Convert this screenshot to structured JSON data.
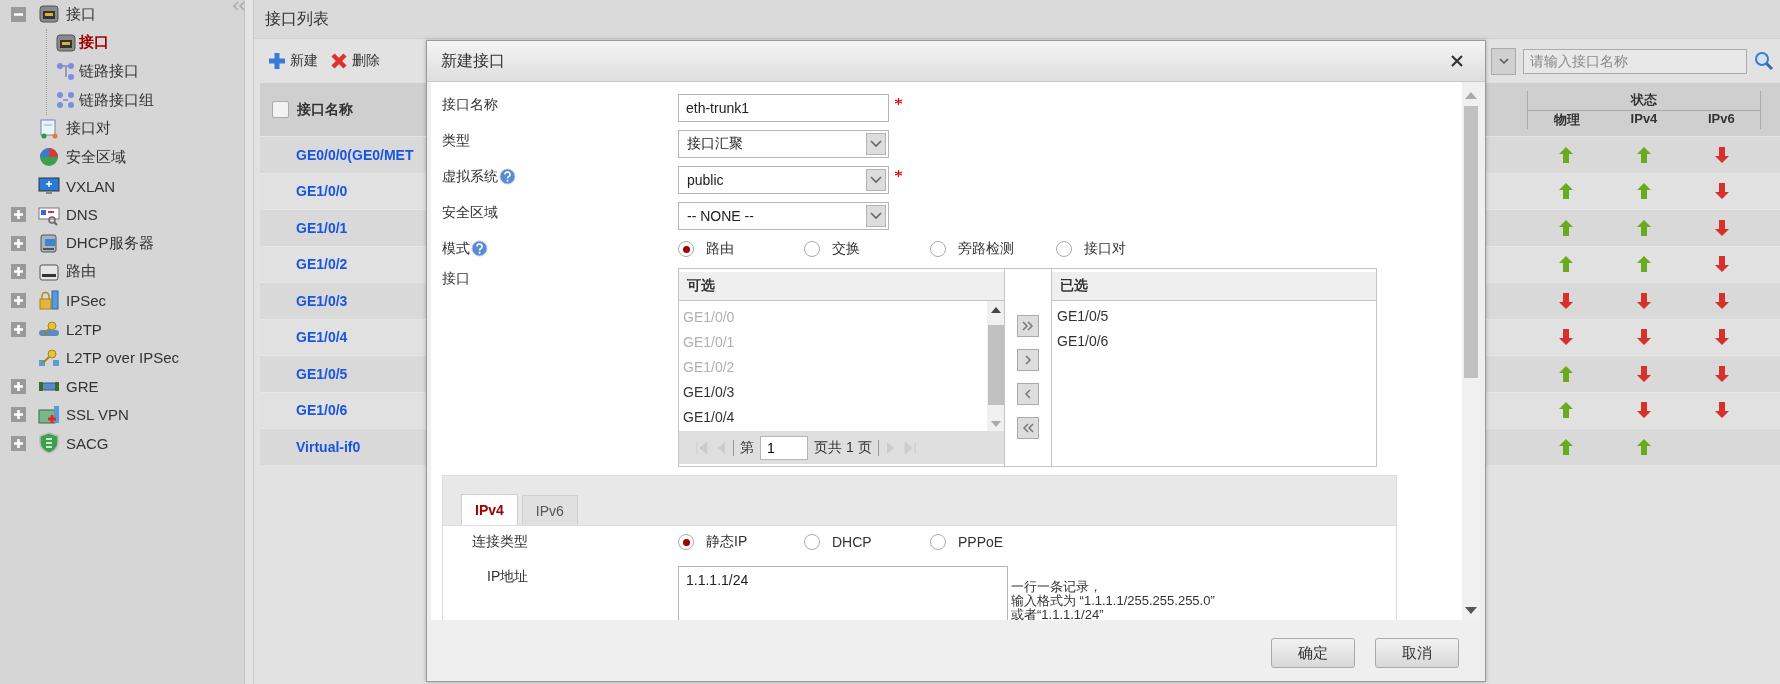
{
  "sidebar": {
    "items": [
      {
        "label": "接口",
        "expanded": true,
        "selected": false,
        "children": [
          {
            "label": "接口",
            "selected": true
          },
          {
            "label": "链路接口",
            "selected": false
          },
          {
            "label": "链路接口组",
            "selected": false
          }
        ]
      },
      {
        "label": "接口对",
        "selected": false
      },
      {
        "label": "安全区域",
        "selected": false
      },
      {
        "label": "VXLAN",
        "selected": false
      },
      {
        "label": "DNS",
        "expanded": false,
        "selected": false
      },
      {
        "label": "DHCP服务器",
        "expanded": false,
        "selected": false
      },
      {
        "label": "路由",
        "expanded": false,
        "selected": false
      },
      {
        "label": "IPSec",
        "expanded": false,
        "selected": false
      },
      {
        "label": "L2TP",
        "expanded": false,
        "selected": false
      },
      {
        "label": "L2TP over IPSec",
        "selected": false
      },
      {
        "label": "GRE",
        "expanded": false,
        "selected": false
      },
      {
        "label": "SSL VPN",
        "expanded": false,
        "selected": false
      },
      {
        "label": "SACG",
        "expanded": false,
        "selected": false
      }
    ]
  },
  "panel": {
    "title": "接口列表",
    "toolbar": {
      "buttons": [
        {
          "label": "新建",
          "kind": "add"
        },
        {
          "label": "删除",
          "kind": "delete"
        }
      ],
      "search": {
        "placeholder": "请输入接口名称"
      }
    },
    "table": {
      "select_all": {
        "checked": false
      },
      "name_column": "接口名称",
      "status_group": "状态",
      "status_columns": [
        "物理",
        "IPv4",
        "IPv6"
      ],
      "rows": [
        {
          "name": "GE0/0/0(GE0/MET",
          "status": [
            {
              "up": true
            },
            {
              "up": true
            },
            {
              "up": false
            }
          ]
        },
        {
          "name": "GE1/0/0",
          "status": [
            {
              "up": true
            },
            {
              "up": true
            },
            {
              "up": false
            }
          ]
        },
        {
          "name": "GE1/0/1",
          "status": [
            {
              "up": true
            },
            {
              "up": true
            },
            {
              "up": false
            }
          ]
        },
        {
          "name": "GE1/0/2",
          "status": [
            {
              "up": true
            },
            {
              "up": true
            },
            {
              "up": false
            }
          ]
        },
        {
          "name": "GE1/0/3",
          "status": [
            {
              "up": false
            },
            {
              "up": false
            },
            {
              "up": false
            }
          ]
        },
        {
          "name": "GE1/0/4",
          "status": [
            {
              "up": false
            },
            {
              "up": false
            },
            {
              "up": false
            }
          ]
        },
        {
          "name": "GE1/0/5",
          "status": [
            {
              "up": true
            },
            {
              "up": false
            },
            {
              "up": false
            }
          ]
        },
        {
          "name": "GE1/0/6",
          "status": [
            {
              "up": true
            },
            {
              "up": false
            },
            {
              "up": false
            }
          ]
        },
        {
          "name": "Virtual-if0",
          "status": [
            {
              "up": true
            },
            {
              "up": true
            }
          ]
        }
      ]
    }
  },
  "dialog": {
    "title": "新建接口",
    "fields": [
      {
        "kind": "text",
        "label": "接口名称",
        "help": false,
        "value": "eth-trunk1",
        "required": true
      },
      {
        "kind": "select",
        "label": "类型",
        "help": false,
        "value": "接口汇聚",
        "required": false
      },
      {
        "kind": "select",
        "label": "虚拟系统",
        "help": true,
        "value": "public",
        "required": true
      },
      {
        "kind": "select",
        "label": "安全区域",
        "help": false,
        "value": "-- NONE --",
        "required": false
      },
      {
        "kind": "radio",
        "label": "模式",
        "help": true,
        "options": [
          {
            "label": "路由",
            "selected": true
          },
          {
            "label": "交换",
            "selected": false
          },
          {
            "label": "旁路检测",
            "selected": false
          },
          {
            "label": "接口对",
            "selected": false
          }
        ]
      },
      {
        "kind": "transfer",
        "label": "接口",
        "help": false,
        "available": {
          "title": "可选",
          "items": [
            {
              "label": "GE1/0/0",
              "disabled": true
            },
            {
              "label": "GE1/0/1",
              "disabled": true
            },
            {
              "label": "GE1/0/2",
              "disabled": true
            },
            {
              "label": "GE1/0/3",
              "disabled": false
            },
            {
              "label": "GE1/0/4",
              "disabled": false
            }
          ],
          "pager": {
            "prefix": "第",
            "page": "1",
            "suffix": "页共 1 页"
          }
        },
        "chosen": {
          "title": "已选",
          "items": [
            "GE1/0/5",
            "GE1/0/6"
          ]
        }
      }
    ],
    "tabs": [
      {
        "label": "IPv4",
        "selected": true
      },
      {
        "label": "IPv6",
        "selected": false
      }
    ],
    "connection": {
      "label": "连接类型",
      "options": [
        {
          "label": "静态IP",
          "selected": true
        },
        {
          "label": "DHCP",
          "selected": false
        },
        {
          "label": "PPPoE",
          "selected": false
        }
      ]
    },
    "ip": {
      "label": "IP地址",
      "value": "1.1.1.1/24",
      "hint": [
        "一行一条记录，",
        "输入格式为 “1.1.1.1/255.255.255.0”",
        "或者“1.1.1.1/24”"
      ]
    },
    "buttons": [
      "确定",
      "取消"
    ]
  }
}
